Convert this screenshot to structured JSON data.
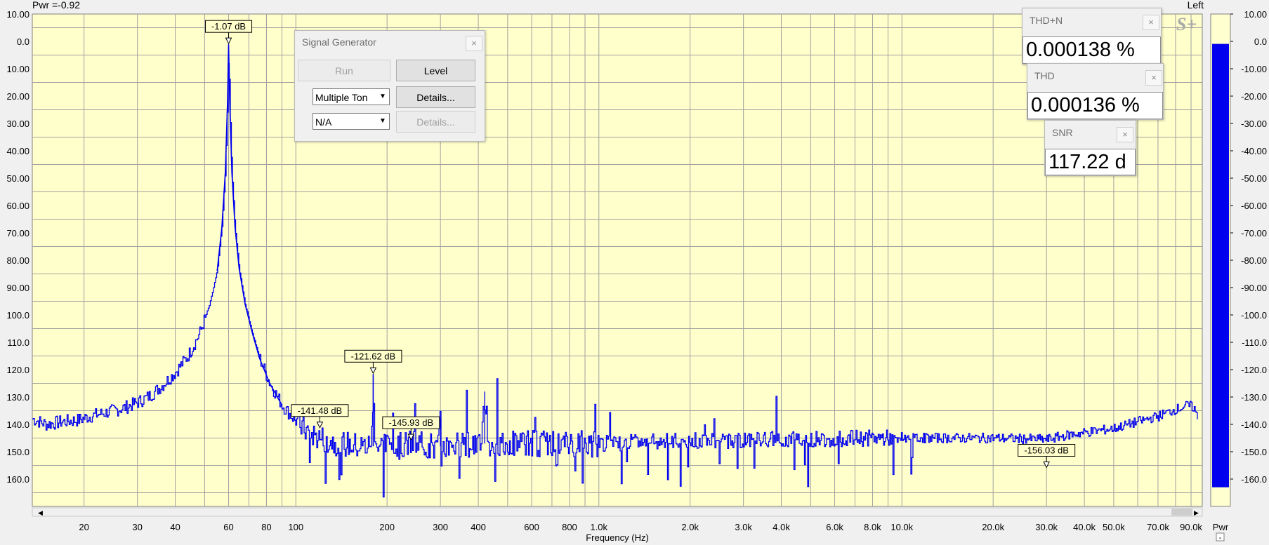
{
  "header": {
    "power_readout": "Pwr =-0.92",
    "channel": "Left"
  },
  "chart_data": {
    "type": "line",
    "title": "",
    "xlabel": "Frequency (Hz)",
    "ylabel": "",
    "xscale": "log",
    "xlim": [
      13.5,
      98000
    ],
    "ylim": [
      -170,
      10
    ],
    "x_ticks": [
      {
        "v": 20,
        "l": "20"
      },
      {
        "v": 30,
        "l": "30"
      },
      {
        "v": 40,
        "l": "40"
      },
      {
        "v": 60,
        "l": "60"
      },
      {
        "v": 80,
        "l": "80"
      },
      {
        "v": 100,
        "l": "100"
      },
      {
        "v": 200,
        "l": "200"
      },
      {
        "v": 300,
        "l": "300"
      },
      {
        "v": 400,
        "l": "400"
      },
      {
        "v": 600,
        "l": "600"
      },
      {
        "v": 800,
        "l": "800"
      },
      {
        "v": 1000,
        "l": "1.0k"
      },
      {
        "v": 2000,
        "l": "2.0k"
      },
      {
        "v": 3000,
        "l": "3.0k"
      },
      {
        "v": 4000,
        "l": "4.0k"
      },
      {
        "v": 6000,
        "l": "6.0k"
      },
      {
        "v": 8000,
        "l": "8.0k"
      },
      {
        "v": 10000,
        "l": "10.0k"
      },
      {
        "v": 20000,
        "l": "20.0k"
      },
      {
        "v": 30000,
        "l": "30.0k"
      },
      {
        "v": 40000,
        "l": "40.0k"
      },
      {
        "v": 50000,
        "l": "50.0k"
      },
      {
        "v": 70000,
        "l": "70.0k"
      },
      {
        "v": 90000,
        "l": "90.0k"
      }
    ],
    "y_ticks": [
      {
        "v": 10,
        "l": "10.00"
      },
      {
        "v": 0,
        "l": "0.0"
      },
      {
        "v": -10,
        "l": "10.00"
      },
      {
        "v": -20,
        "l": "20.00"
      },
      {
        "v": -30,
        "l": "30.00"
      },
      {
        "v": -40,
        "l": "40.00"
      },
      {
        "v": -50,
        "l": "50.00"
      },
      {
        "v": -60,
        "l": "60.00"
      },
      {
        "v": -70,
        "l": "70.00"
      },
      {
        "v": -80,
        "l": "80.00"
      },
      {
        "v": -90,
        "l": "90.00"
      },
      {
        "v": -100,
        "l": "100.0"
      },
      {
        "v": -110,
        "l": "110.0"
      },
      {
        "v": -120,
        "l": "120.0"
      },
      {
        "v": -130,
        "l": "130.0"
      },
      {
        "v": -140,
        "l": "140.0"
      },
      {
        "v": -150,
        "l": "150.0"
      },
      {
        "v": -160,
        "l": "160.0"
      }
    ],
    "series": [
      {
        "color": "#0000ee",
        "points": [
          [
            13.5,
            -138
          ],
          [
            15,
            -140
          ],
          [
            17,
            -139
          ],
          [
            19,
            -138.5
          ],
          [
            21,
            -137
          ],
          [
            24,
            -135.5
          ],
          [
            27,
            -134
          ],
          [
            30,
            -132
          ],
          [
            33,
            -129.5
          ],
          [
            36,
            -126
          ],
          [
            40,
            -121
          ],
          [
            44,
            -115
          ],
          [
            48,
            -107
          ],
          [
            52,
            -96
          ],
          [
            55,
            -84
          ],
          [
            57,
            -68
          ],
          [
            58.5,
            -48
          ],
          [
            59.5,
            -22
          ],
          [
            60,
            -1.07
          ],
          [
            60.5,
            -22
          ],
          [
            61.5,
            -48
          ],
          [
            63,
            -68
          ],
          [
            65,
            -83
          ],
          [
            68,
            -96
          ],
          [
            72,
            -107
          ],
          [
            76,
            -116
          ],
          [
            82,
            -125
          ],
          [
            90,
            -133
          ],
          [
            100,
            -139
          ],
          [
            110,
            -143
          ],
          [
            120,
            -145
          ],
          [
            140,
            -147
          ],
          [
            160,
            -148
          ],
          [
            175,
            -148
          ],
          [
            179,
            -140
          ],
          [
            180,
            -121.62
          ],
          [
            181,
            -140
          ],
          [
            185,
            -148
          ],
          [
            220,
            -148
          ],
          [
            240,
            -147
          ],
          [
            270,
            -148
          ],
          [
            295,
            -148
          ],
          [
            300,
            -138
          ],
          [
            305,
            -148
          ],
          [
            400,
            -147
          ],
          [
            410,
            -147
          ],
          [
            420,
            -128
          ],
          [
            430,
            -147
          ],
          [
            600,
            -147
          ],
          [
            1000,
            -147
          ],
          [
            2000,
            -146
          ],
          [
            4000,
            -145.5
          ],
          [
            8000,
            -145
          ],
          [
            15000,
            -145
          ],
          [
            20000,
            -145
          ],
          [
            30000,
            -145.5
          ],
          [
            35000,
            -144
          ],
          [
            40000,
            -143
          ],
          [
            50000,
            -141.5
          ],
          [
            60000,
            -139
          ],
          [
            70000,
            -137
          ],
          [
            80000,
            -134.5
          ],
          [
            88000,
            -133
          ],
          [
            92000,
            -134
          ],
          [
            95000,
            -139
          ]
        ]
      }
    ],
    "annotations": [
      {
        "x": 60,
        "y": -1.07,
        "label": "-1.07 dB"
      },
      {
        "x": 180,
        "y": -121.62,
        "label": "-121.62 dB"
      },
      {
        "x": 120,
        "y": -141.48,
        "label": "-141.48 dB"
      },
      {
        "x": 240,
        "y": -145.93,
        "label": "-145.93 dB"
      },
      {
        "x": 30000,
        "y": -156.03,
        "label": "-156.03 dB"
      }
    ],
    "colors": {
      "plot_bg": "#ffffcc",
      "grid": "#a0a0a0",
      "trace": "#0000ee"
    }
  },
  "level_meter": {
    "ticks": [
      "10.00",
      "0.0",
      "-10.00",
      "-20.00",
      "-30.00",
      "-40.00",
      "-50.00",
      "-60.00",
      "-70.00",
      "-80.00",
      "-90.00",
      "-100.0",
      "-110.0",
      "-120.0",
      "-130.0",
      "-140.0",
      "-150.0",
      "-160.0"
    ],
    "value": -0.92,
    "label": "Pwr",
    "button": "-",
    "color": "#0000ee"
  },
  "signal_generator": {
    "title": "Signal Generator",
    "run_label": "Run",
    "level_label": "Level",
    "mode_value": "Multiple Ton",
    "details_label": "Details...",
    "source_value": "N/A",
    "details2_label": "Details..."
  },
  "meters": {
    "thdn": {
      "title": "THD+N",
      "value": "0.000138 %"
    },
    "thd": {
      "title": "THD",
      "value": "0.000136 %"
    },
    "snr": {
      "title": "SNR",
      "value": "117.22 d"
    }
  },
  "logo": "S+",
  "close_glyph": "×",
  "scroll": {
    "left": "◀",
    "right": "▶"
  }
}
